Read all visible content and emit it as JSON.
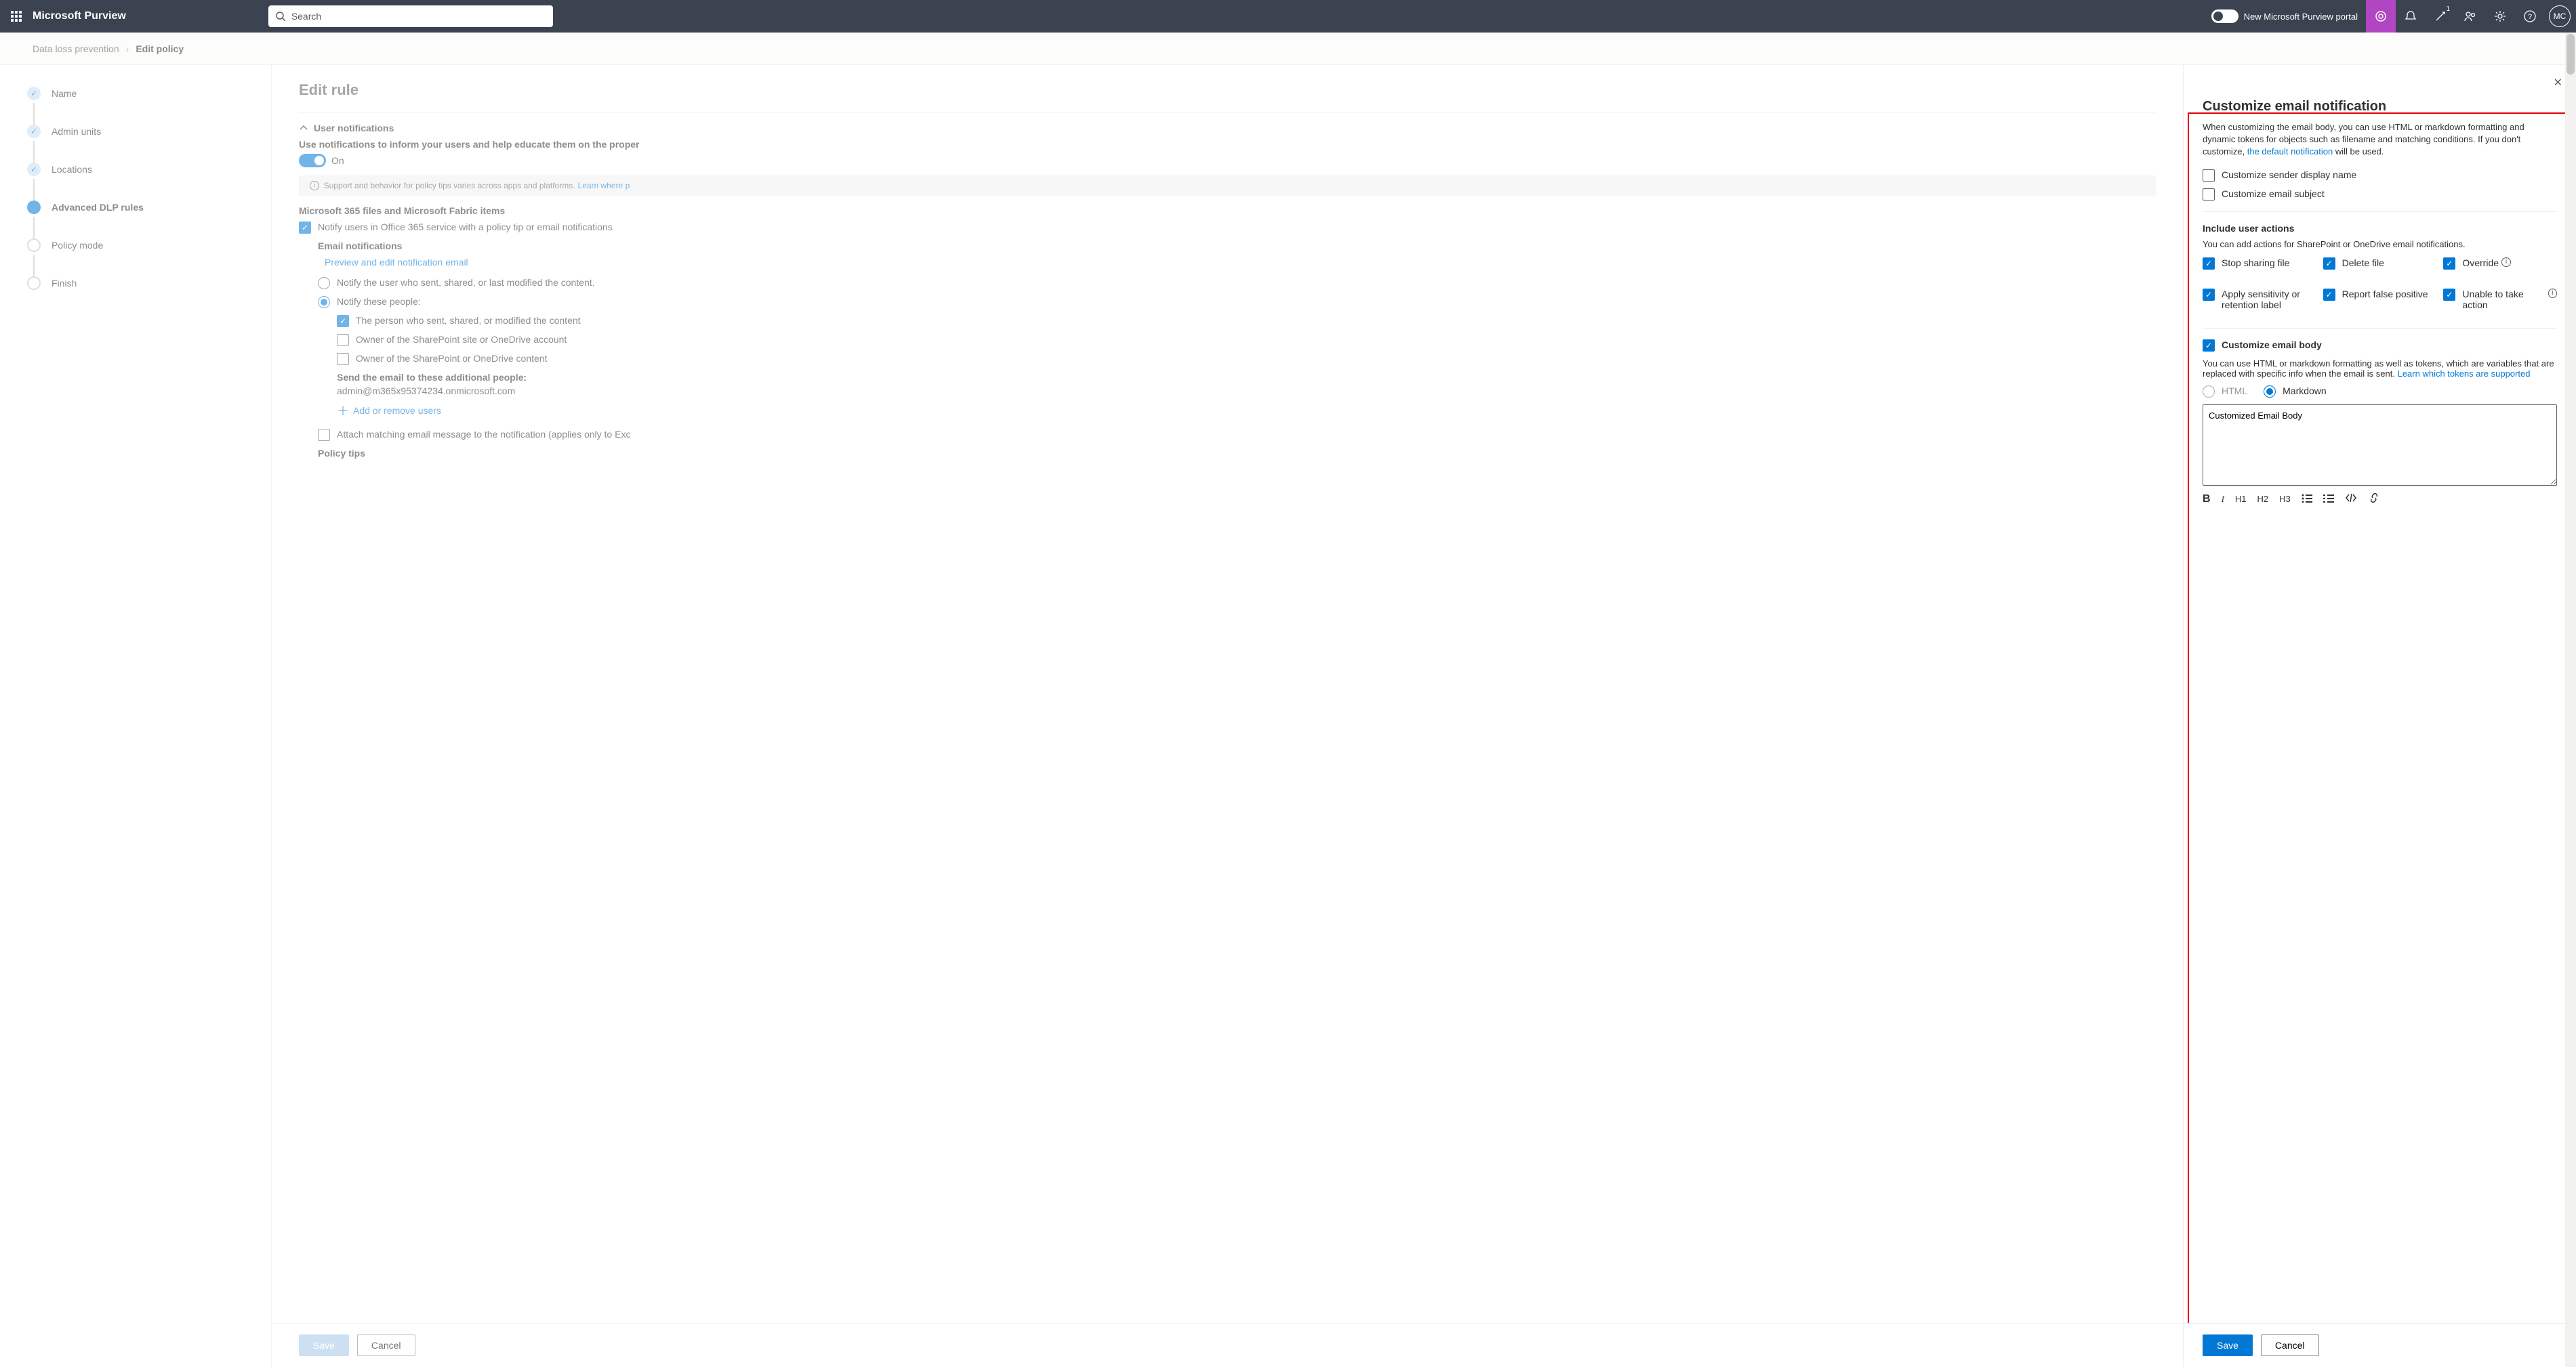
{
  "header": {
    "brand": "Microsoft Purview",
    "search_placeholder": "Search",
    "portal_toggle_label": "New Microsoft Purview portal",
    "notification_badge": "1",
    "avatar_initials": "MC"
  },
  "breadcrumb": {
    "parent": "Data loss prevention",
    "current": "Edit policy"
  },
  "stepper": [
    {
      "label": "Name",
      "state": "done"
    },
    {
      "label": "Admin units",
      "state": "done"
    },
    {
      "label": "Locations",
      "state": "done"
    },
    {
      "label": "Advanced DLP rules",
      "state": "active"
    },
    {
      "label": "Policy mode",
      "state": "pending"
    },
    {
      "label": "Finish",
      "state": "pending"
    }
  ],
  "edit_rule": {
    "title": "Edit rule",
    "section": "User notifications",
    "intro": "Use notifications to inform your users and help educate them on the proper",
    "toggle_label": "On",
    "info_text": "Support and behavior for policy tips varies across apps and platforms.",
    "info_link": "Learn where p",
    "files_heading": "Microsoft 365 files and Microsoft Fabric items",
    "notify_checkbox": "Notify users in Office 365 service with a policy tip or email notifications",
    "email_heading": "Email notifications",
    "preview_link": "Preview and edit notification email",
    "radio1": "Notify the user who sent, shared, or last modified the content.",
    "radio2": "Notify these people:",
    "cb_person": "The person who sent, shared, or modified the content",
    "cb_site_owner": "Owner of the SharePoint site or OneDrive account",
    "cb_content_owner": "Owner of the SharePoint or OneDrive content",
    "additional_label": "Send the email to these additional people:",
    "additional_value": "admin@m365x95374234.onmicrosoft.com",
    "add_remove": "Add or remove users",
    "attach_cb": "Attach matching email message to the notification (applies only to Exc",
    "policy_tips": "Policy tips",
    "save": "Save",
    "cancel": "Cancel"
  },
  "customize": {
    "title": "Customize email notification",
    "desc_pre": "When customizing the email body, you can use HTML or markdown formatting and dynamic tokens for objects such as filename and matching conditions. If you don't customize, ",
    "desc_link": "the default notification",
    "desc_post": " will be used.",
    "cb_sender": "Customize sender display name",
    "cb_subject": "Customize email subject",
    "actions_heading": "Include user actions",
    "actions_sub": "You can add actions for SharePoint or OneDrive email notifications.",
    "actions": {
      "stop_sharing": "Stop sharing file",
      "delete_file": "Delete file",
      "override": "Override",
      "apply_label": "Apply sensitivity or retention label",
      "report_false": "Report false positive",
      "unable": "Unable to take action"
    },
    "cb_body": "Customize email body",
    "body_sub_pre": "You can use HTML or markdown formatting as well as tokens, which are variables that are replaced with specific info when the email is sent. ",
    "body_sub_link": "Learn which tokens are supported",
    "fmt_html": "HTML",
    "fmt_md": "Markdown",
    "body_value": "Customized Email Body",
    "toolbar": {
      "b": "B",
      "i": "I",
      "h1": "H1",
      "h2": "H2",
      "h3": "H3"
    },
    "save": "Save",
    "cancel": "Cancel"
  }
}
